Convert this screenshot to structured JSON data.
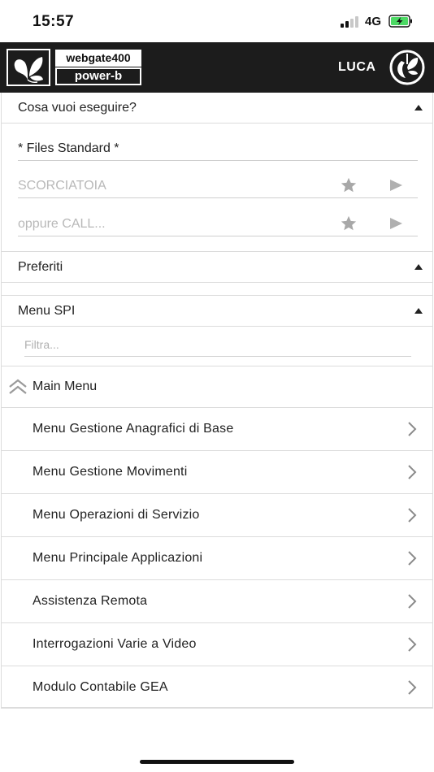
{
  "status_bar": {
    "time": "15:57",
    "network": "4G",
    "signal_bars": 2,
    "battery_state": "charging"
  },
  "header": {
    "brand_top": "webgate400",
    "brand_bottom": "power-b",
    "user": "LUCA",
    "background_color": "#1c1c1c",
    "icons": {
      "logo": "butterfly-logo-icon",
      "power": "power-icon"
    }
  },
  "run_section": {
    "title": "Cosa vuoi eseguire?",
    "selected_file": "* Files Standard *",
    "shortcut_placeholder": "SCORCIATOIA",
    "call_placeholder": "oppure CALL...",
    "icons": {
      "favorite": "star-icon",
      "run": "play-icon",
      "collapse": "caret-up-icon"
    }
  },
  "favorites_section": {
    "title": "Preferiti"
  },
  "menu_section": {
    "title": "Menu SPI",
    "filter_placeholder": "Filtra...",
    "root_label": "Main Menu",
    "items": [
      {
        "label": "Menu Gestione Anagrafici di Base"
      },
      {
        "label": "Menu Gestione Movimenti"
      },
      {
        "label": "Menu Operazioni di Servizio"
      },
      {
        "label": "Menu Principale Applicazioni"
      },
      {
        "label": "Assistenza Remota"
      },
      {
        "label": "Interrogazioni Varie a Video"
      },
      {
        "label": "Modulo Contabile GEA"
      }
    ]
  }
}
